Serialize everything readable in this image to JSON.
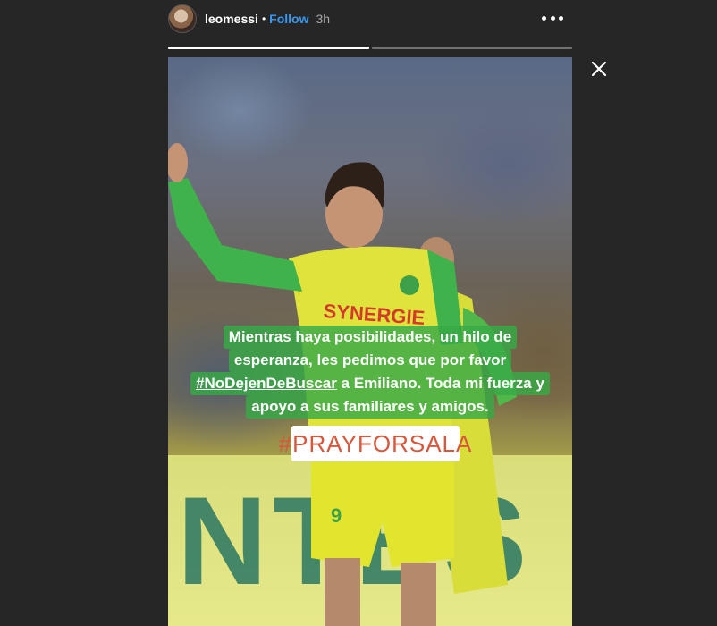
{
  "header": {
    "username": "leomessi",
    "separator": "•",
    "follow_label": "Follow",
    "time": "3h"
  },
  "progress": {
    "segments": 2,
    "current_fill": 1.0
  },
  "story": {
    "caption_lines": [
      {
        "before": "Mientras haya posibilidades, un hilo de",
        "tag": "",
        "after": ""
      },
      {
        "before": "esperanza, les pedimos que por favor",
        "tag": "",
        "after": ""
      },
      {
        "before": "",
        "tag": "#NoDejenDeBuscar",
        "after": " a Emiliano. Toda mi fuerza y"
      },
      {
        "before": "apoyo a sus familiares y amigos.",
        "tag": "",
        "after": ""
      }
    ],
    "sticker_text": "#PRAYFORSALA",
    "jersey_text": "SYNERGIE",
    "banner_text": "NTES"
  },
  "icons": {
    "more": "more-dots-icon",
    "close": "close-icon"
  },
  "colors": {
    "background": "#262626",
    "follow": "#3897f0",
    "caption_bg": "#37aa46",
    "sticker_text": "#d6573c"
  }
}
